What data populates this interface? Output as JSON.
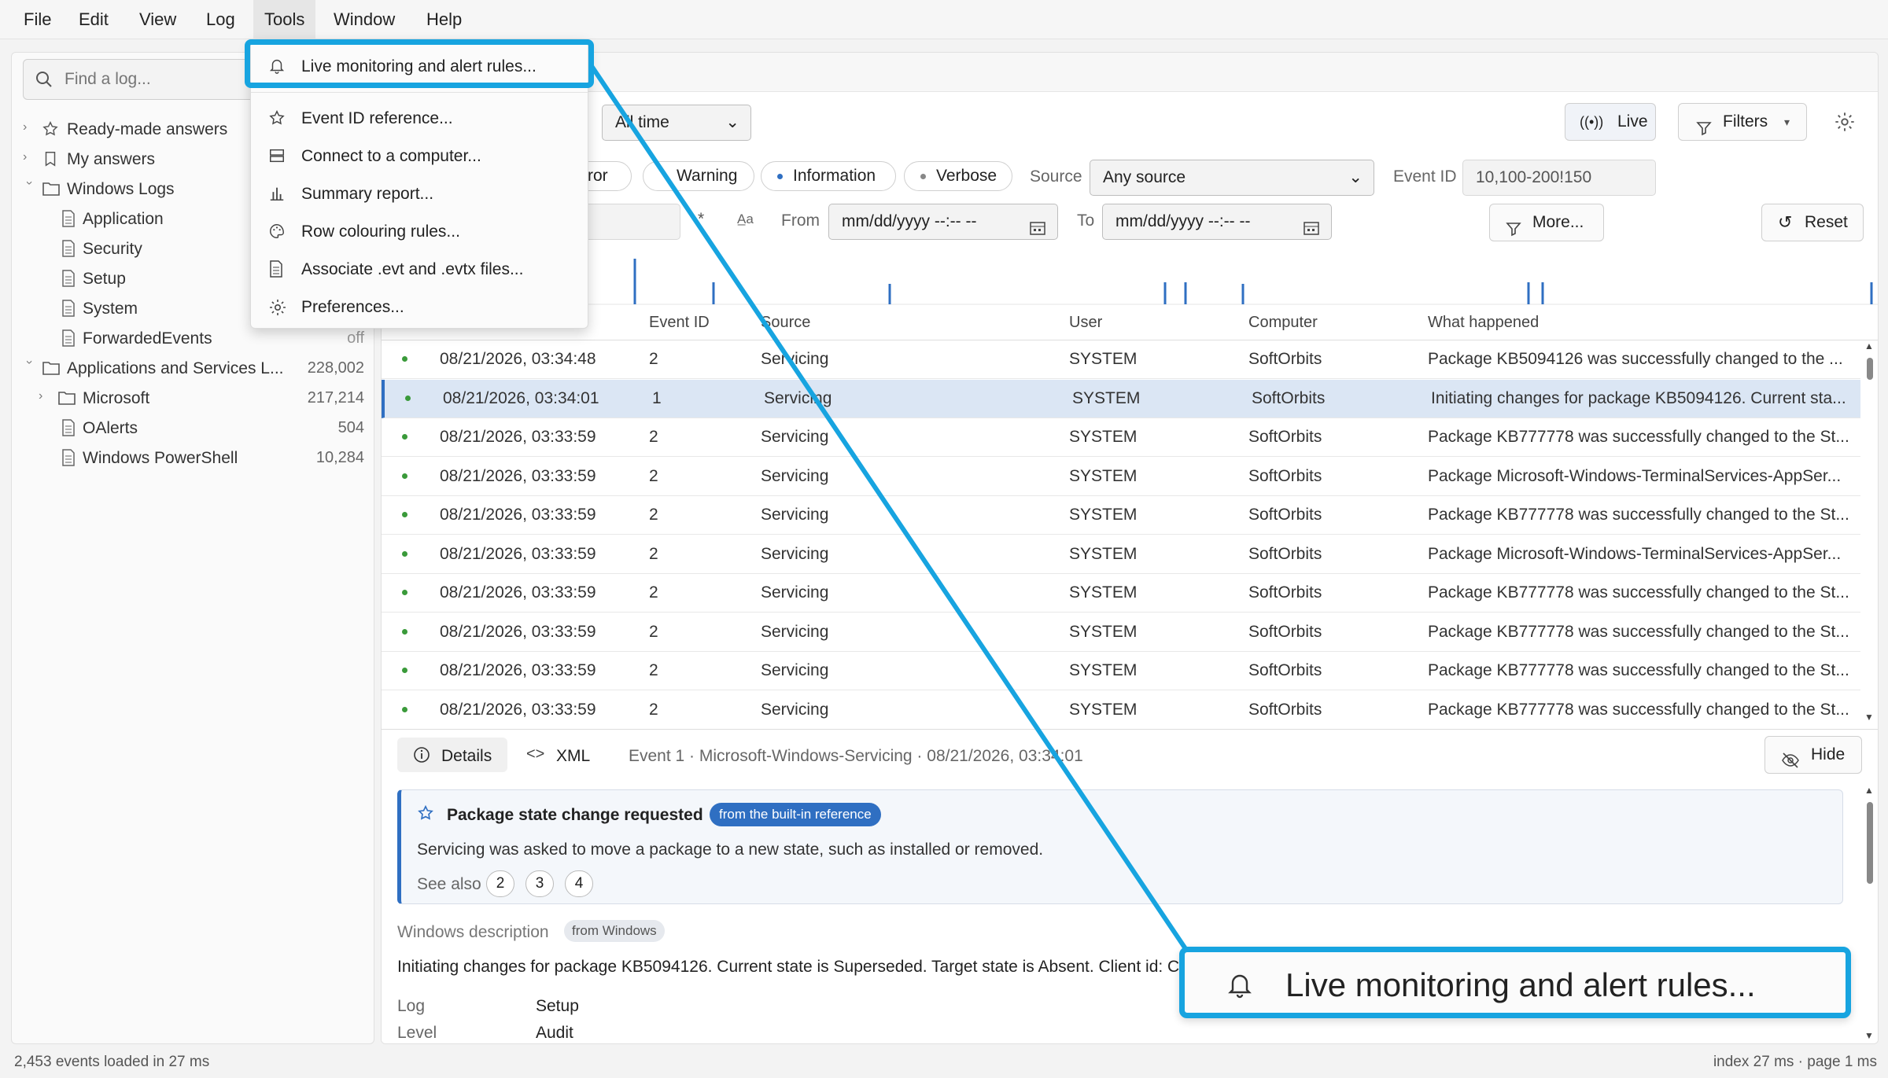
{
  "menubar": {
    "items": [
      "File",
      "Edit",
      "View",
      "Log",
      "Tools",
      "Window",
      "Help"
    ]
  },
  "sidebar": {
    "search_placeholder": "Find a log...",
    "tree": [
      {
        "label": "Ready-made answers",
        "icon": "star-icon",
        "count": ""
      },
      {
        "label": "My answers",
        "icon": "bookmark-icon",
        "count": ""
      },
      {
        "label": "Windows Logs",
        "icon": "folder-icon",
        "count": ""
      },
      {
        "label": "Application",
        "icon": "file-icon",
        "count": ""
      },
      {
        "label": "Security",
        "icon": "file-icon",
        "count": ""
      },
      {
        "label": "Setup",
        "icon": "file-icon",
        "count": ""
      },
      {
        "label": "System",
        "icon": "file-icon",
        "count": ""
      },
      {
        "label": "ForwardedEvents",
        "icon": "file-icon",
        "count": "off"
      },
      {
        "label": "Applications and Services L...",
        "icon": "folder-icon",
        "count": "228,002"
      },
      {
        "label": "Microsoft",
        "icon": "folder-icon",
        "count": "217,214"
      },
      {
        "label": "OAlerts",
        "icon": "file-icon",
        "count": "504"
      },
      {
        "label": "Windows PowerShell",
        "icon": "file-icon",
        "count": "10,284"
      }
    ]
  },
  "toolbar": {
    "time_range": "All time",
    "live_label": "Live",
    "filters_label": "Filters",
    "level_error": "Error",
    "level_warning": "Warning",
    "level_information": "Information",
    "level_verbose": "Verbose",
    "source_label": "Source",
    "source_value": "Any source",
    "event_id_label": "Event ID",
    "event_id_value": "10,100-200!150",
    "from_label": "From",
    "from_value": "mm/dd/yyyy --:-- --",
    "to_label": "To",
    "to_value": "mm/dd/yyyy --:-- --",
    "more_label": "More...",
    "reset_label": "Reset",
    "regex_label": "*",
    "case_label": "A̲a"
  },
  "table": {
    "columns": [
      "Event ID",
      "Source",
      "User",
      "Computer",
      "What happened"
    ],
    "rows": [
      {
        "time": "08/21/2026, 03:34:48",
        "id": "2",
        "source": "Servicing",
        "user": "SYSTEM",
        "computer": "SoftOrbits",
        "what": "Package KB5094126 was successfully changed to the ..."
      },
      {
        "time": "08/21/2026, 03:34:01",
        "id": "1",
        "source": "Servicing",
        "user": "SYSTEM",
        "computer": "SoftOrbits",
        "what": "Initiating changes for package KB5094126. Current sta..."
      },
      {
        "time": "08/21/2026, 03:33:59",
        "id": "2",
        "source": "Servicing",
        "user": "SYSTEM",
        "computer": "SoftOrbits",
        "what": "Package KB777778 was successfully changed to the St..."
      },
      {
        "time": "08/21/2026, 03:33:59",
        "id": "2",
        "source": "Servicing",
        "user": "SYSTEM",
        "computer": "SoftOrbits",
        "what": "Package Microsoft-Windows-TerminalServices-AppSer..."
      },
      {
        "time": "08/21/2026, 03:33:59",
        "id": "2",
        "source": "Servicing",
        "user": "SYSTEM",
        "computer": "SoftOrbits",
        "what": "Package KB777778 was successfully changed to the St..."
      },
      {
        "time": "08/21/2026, 03:33:59",
        "id": "2",
        "source": "Servicing",
        "user": "SYSTEM",
        "computer": "SoftOrbits",
        "what": "Package Microsoft-Windows-TerminalServices-AppSer..."
      },
      {
        "time": "08/21/2026, 03:33:59",
        "id": "2",
        "source": "Servicing",
        "user": "SYSTEM",
        "computer": "SoftOrbits",
        "what": "Package KB777778 was successfully changed to the St..."
      },
      {
        "time": "08/21/2026, 03:33:59",
        "id": "2",
        "source": "Servicing",
        "user": "SYSTEM",
        "computer": "SoftOrbits",
        "what": "Package KB777778 was successfully changed to the St..."
      },
      {
        "time": "08/21/2026, 03:33:59",
        "id": "2",
        "source": "Servicing",
        "user": "SYSTEM",
        "computer": "SoftOrbits",
        "what": "Package KB777778 was successfully changed to the St..."
      },
      {
        "time": "08/21/2026, 03:33:59",
        "id": "2",
        "source": "Servicing",
        "user": "SYSTEM",
        "computer": "SoftOrbits",
        "what": "Package KB777778 was successfully changed to the St..."
      }
    ],
    "selected_row": 1
  },
  "details": {
    "tab_details": "Details",
    "tab_xml": "XML",
    "event_summary": "Event 1 · Microsoft-Windows-Servicing · 08/21/2026, 03:34:01",
    "hide_label": "Hide",
    "card_title": "Package state change requested",
    "card_badge": "from the built-in reference",
    "card_text": "Servicing was asked to move a package to a new state, such as installed or removed.",
    "see_also_label": "See also",
    "see_also": [
      "2",
      "3",
      "4"
    ],
    "win_desc_label": "Windows description",
    "win_desc_badge": "from Windows",
    "win_desc_text": "Initiating changes for package KB5094126. Current state is Superseded. Target state is Absent. Client id: C",
    "log_label": "Log",
    "log_value": "Setup",
    "level_label": "Level",
    "level_value": "Audit"
  },
  "tools_menu": {
    "items": [
      {
        "label": "Live monitoring and alert rules...",
        "icon": "bell-icon"
      },
      {
        "label": "Event ID reference...",
        "icon": "star-icon"
      },
      {
        "label": "Connect to a computer...",
        "icon": "server-icon"
      },
      {
        "label": "Summary report...",
        "icon": "bar-chart-icon"
      },
      {
        "label": "Row colouring rules...",
        "icon": "palette-icon"
      },
      {
        "label": "Associate .evt and .evtx files...",
        "icon": "file-icon"
      },
      {
        "label": "Preferences...",
        "icon": "gear-icon"
      }
    ]
  },
  "callout": {
    "label": "Live monitoring and alert rules...",
    "color": "#17a4e0"
  },
  "status": {
    "left": "2,453 events loaded in 27 ms",
    "right": "index 27 ms · page 1 ms"
  },
  "colors": {
    "accent": "#2f6fc2",
    "badge": "#2f6fc2",
    "dot_green": "#3a9a3a",
    "highlight": "#17a4e0",
    "selected_row": "#dbe6f4"
  }
}
